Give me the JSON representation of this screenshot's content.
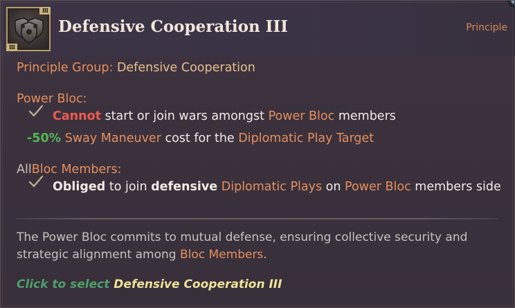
{
  "header": {
    "title": "Defensive Cooperation III",
    "type_label": "Principle",
    "tier_badge": "III",
    "icon": "shields-icon"
  },
  "group": {
    "label": "Principle Group:",
    "value": "Defensive Cooperation"
  },
  "power_bloc": {
    "heading": "Power Bloc:",
    "effect1": {
      "cannot": "Cannot",
      "text1": "start or join wars amongst",
      "link": "Power Bloc",
      "text2": "members"
    },
    "effect2": {
      "value": "-50%",
      "link1": "Sway Maneuver",
      "text": "cost for the",
      "link2": "Diplomatic Play Target"
    }
  },
  "bloc_members": {
    "heading_prefix": "All",
    "heading_link": "Bloc Members:",
    "effect": {
      "obliged": "Obliged",
      "text1": "to join",
      "defensive": "defensive",
      "link1": "Diplomatic Plays",
      "text2": "on",
      "link2": "Power Bloc",
      "text3": "members side"
    }
  },
  "description": {
    "line1": "The Power Bloc commits to mutual defense, ensuring collective security and",
    "line2_prefix": "strategic alignment among",
    "line2_link": "Bloc Members",
    "line2_suffix": "."
  },
  "footer": {
    "action": "Click to select",
    "name": "Defensive Cooperation III"
  },
  "colors": {
    "tan": "#e7bf8d",
    "orange": "#e88f5d",
    "red": "#ec5c4e",
    "green": "#53b755",
    "footer_green": "#4f9e6a",
    "footer_yellow": "#efe29a"
  }
}
